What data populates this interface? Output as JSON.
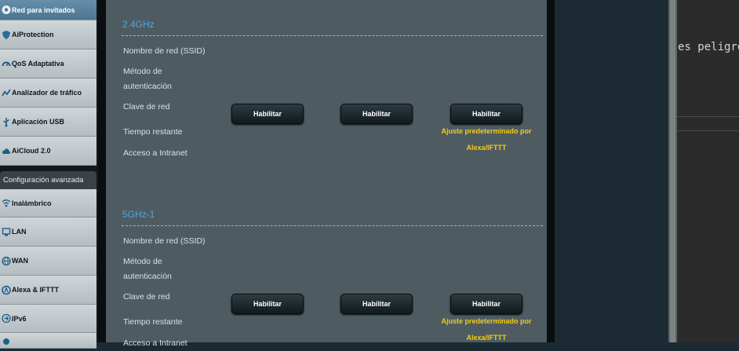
{
  "sidebar": {
    "items": [
      {
        "label": "Red para invitados",
        "icon": "guest-network-icon",
        "active": true
      },
      {
        "label": "AiProtection",
        "icon": "shield-icon",
        "active": false
      },
      {
        "label": "QoS Adaptativa",
        "icon": "qos-gauge-icon",
        "active": false
      },
      {
        "label": "Analizador de tráfico",
        "icon": "traffic-analyzer-icon",
        "active": false
      },
      {
        "label": "Aplicación USB",
        "icon": "usb-icon",
        "active": false
      },
      {
        "label": "AiCloud 2.0",
        "icon": "cloud-icon",
        "active": false
      }
    ],
    "advanced_header": "Configuración avanzada",
    "advanced_items": [
      {
        "label": "Inalámbrico",
        "icon": "wireless-icon"
      },
      {
        "label": "LAN",
        "icon": "lan-icon"
      },
      {
        "label": "WAN",
        "icon": "wan-globe-icon"
      },
      {
        "label": "Alexa & IFTTT",
        "icon": "alexa-ifttt-icon"
      },
      {
        "label": "IPv6",
        "icon": "ipv6-icon"
      }
    ]
  },
  "main": {
    "sections": [
      {
        "title": "2.4GHz",
        "labels": [
          "Nombre de red (SSID)",
          "Método de autenticación",
          "Clave de red",
          "Tiempo restante",
          "Acceso a Intranet"
        ],
        "buttons": [
          "Habilitar",
          "Habilitar",
          "Habilitar"
        ],
        "note_line1": "Ajuste predeterminado por",
        "note_line2": "Alexa/IFTTT"
      },
      {
        "title": "5GHz-1",
        "labels": [
          "Nombre de red (SSID)",
          "Método de autenticación",
          "Clave de red",
          "Tiempo restante",
          "Acceso a Intranet"
        ],
        "buttons": [
          "Habilitar",
          "Habilitar",
          "Habilitar"
        ],
        "note_line1": "Ajuste predeterminado por",
        "note_line2": "Alexa/IFTTT"
      }
    ]
  },
  "background_window": {
    "text": "es peligro"
  },
  "colors": {
    "section_title": "#4aa6e4",
    "note": "#f2cc16",
    "active_nav": "#5a86a4"
  }
}
